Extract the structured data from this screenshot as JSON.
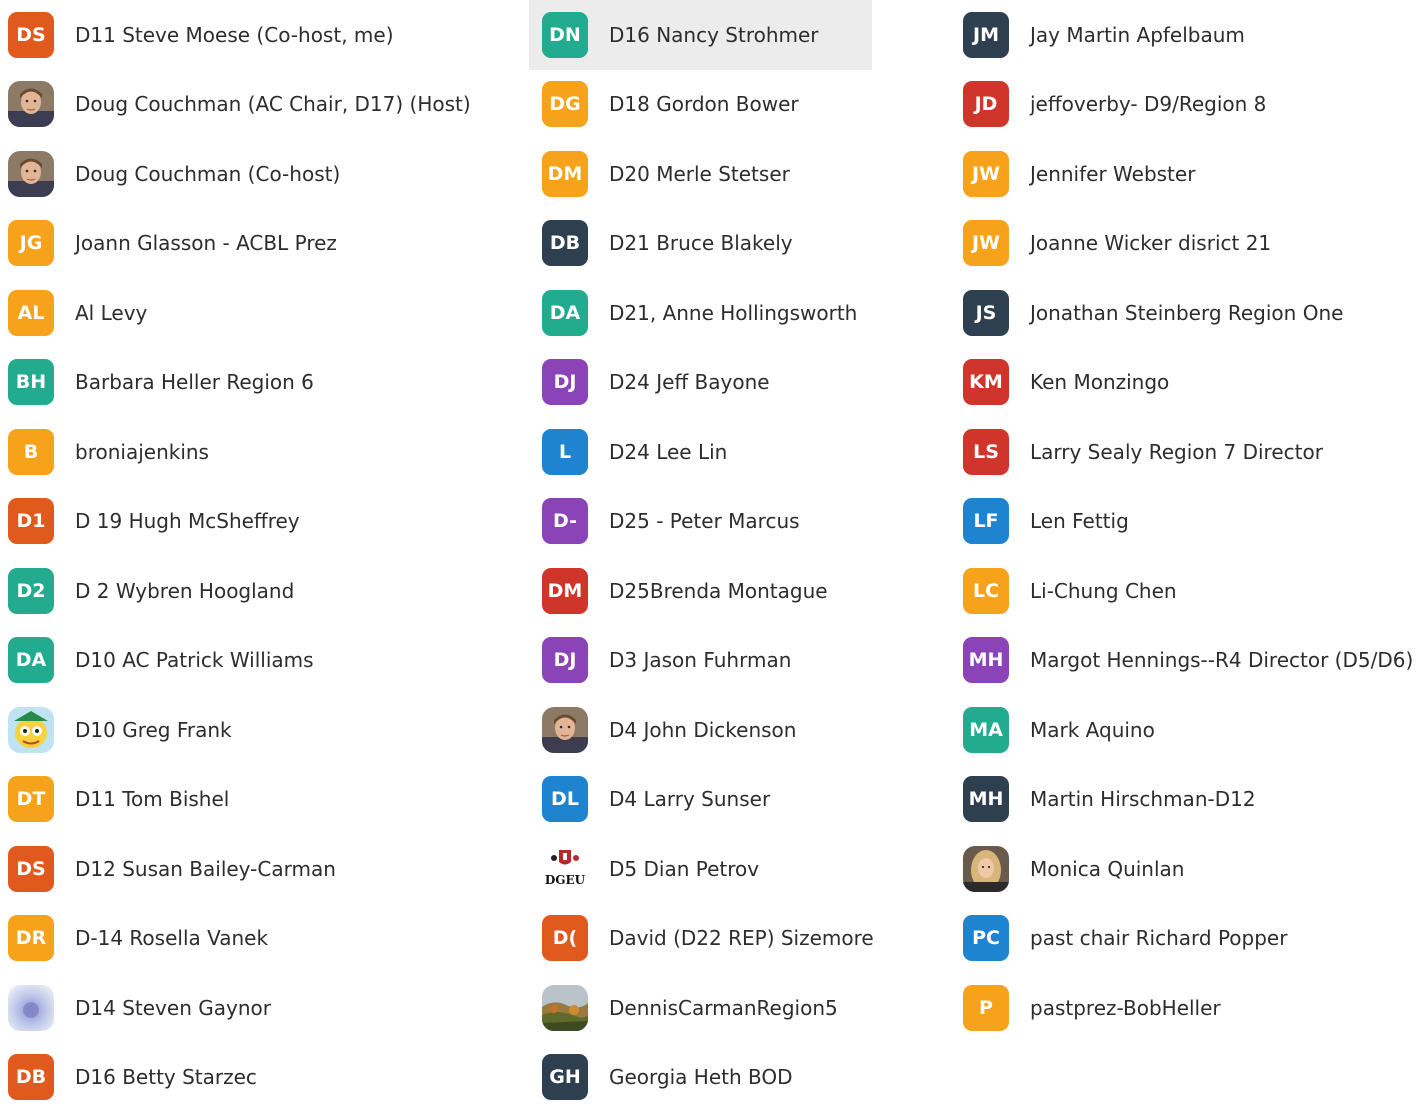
{
  "colors": {
    "orange_red": "#e0591d",
    "orange": "#f6a21a",
    "teal": "#22ab8f",
    "navy": "#2e3f50",
    "purple": "#8b44b8",
    "blue": "#1f84d0",
    "red": "#d0352b",
    "highlight": "#ececec"
  },
  "columns": [
    {
      "participants": [
        {
          "initials": "DS",
          "name": "D11 Steve Moese (Co-host, me)",
          "color": "#e0591d"
        },
        {
          "initials": "",
          "name": "Doug Couchman (AC Chair, D17) (Host)",
          "photo": "man-portrait-photo"
        },
        {
          "initials": "",
          "name": "Doug Couchman (Co-host)",
          "photo": "man-portrait-photo"
        },
        {
          "initials": "JG",
          "name": "Joann Glasson - ACBL Prez",
          "color": "#f6a21a"
        },
        {
          "initials": "AL",
          "name": "Al Levy",
          "color": "#f6a21a"
        },
        {
          "initials": "BH",
          "name": "Barbara Heller Region 6",
          "color": "#22ab8f"
        },
        {
          "initials": "B",
          "name": "broniajenkins",
          "color": "#f6a21a"
        },
        {
          "initials": "D1",
          "name": "D 19   Hugh McSheffrey",
          "color": "#e0591d"
        },
        {
          "initials": "D2",
          "name": "D 2 Wybren Hoogland",
          "color": "#22ab8f"
        },
        {
          "initials": "DA",
          "name": "D10 AC Patrick Williams",
          "color": "#22ab8f"
        },
        {
          "initials": "",
          "name": "D10 Greg Frank",
          "photo": "cartoon-character-photo"
        },
        {
          "initials": "DT",
          "name": "D11 Tom Bishel",
          "color": "#f6a21a"
        },
        {
          "initials": "DS",
          "name": "D12 Susan Bailey-Carman",
          "color": "#e0591d"
        },
        {
          "initials": "DR",
          "name": "D-14 Rosella Vanek",
          "color": "#f6a21a"
        },
        {
          "initials": "",
          "name": "D14 Steven Gaynor",
          "photo": "blurred-abstract-photo"
        },
        {
          "initials": "DB",
          "name": "D16 Betty Starzec",
          "color": "#e0591d"
        }
      ]
    },
    {
      "participants": [
        {
          "initials": "DN",
          "name": "D16 Nancy Strohmer",
          "color": "#22ab8f",
          "highlight": true
        },
        {
          "initials": "DG",
          "name": "D18 Gordon Bower",
          "color": "#f6a21a"
        },
        {
          "initials": "DM",
          "name": "D20 Merle Stetser",
          "color": "#f6a21a"
        },
        {
          "initials": "DB",
          "name": "D21 Bruce Blakely",
          "color": "#2e3f50"
        },
        {
          "initials": "DA",
          "name": "D21, Anne Hollingsworth",
          "color": "#22ab8f"
        },
        {
          "initials": "DJ",
          "name": "D24 Jeff Bayone",
          "color": "#8b44b8"
        },
        {
          "initials": "L",
          "name": "D24 Lee Lin",
          "color": "#1f84d0"
        },
        {
          "initials": "D-",
          "name": "D25 - Peter Marcus",
          "color": "#8b44b8"
        },
        {
          "initials": "DM",
          "name": "D25Brenda Montague",
          "color": "#d0352b"
        },
        {
          "initials": "DJ",
          "name": "D3 Jason Fuhrman",
          "color": "#8b44b8"
        },
        {
          "initials": "",
          "name": "D4 John Dickenson",
          "photo": "man-portrait-photo"
        },
        {
          "initials": "DL",
          "name": "D4 Larry Sunser",
          "color": "#1f84d0"
        },
        {
          "initials": "",
          "name": "D5 Dian Petrov",
          "photo": "logo-image",
          "logo_text": "DGEU"
        },
        {
          "initials": "D(",
          "name": "David (D22 REP) Sizemore",
          "color": "#e0591d"
        },
        {
          "initials": "",
          "name": "DennisCarmanRegion5",
          "photo": "landscape-photo"
        },
        {
          "initials": "GH",
          "name": "Georgia Heth BOD",
          "color": "#2e3f50"
        }
      ]
    },
    {
      "participants": [
        {
          "initials": "JM",
          "name": "Jay Martin Apfelbaum",
          "color": "#2e3f50"
        },
        {
          "initials": "JD",
          "name": "jeffoverby- D9/Region 8",
          "color": "#d0352b"
        },
        {
          "initials": "JW",
          "name": "Jennifer Webster",
          "color": "#f6a21a"
        },
        {
          "initials": "JW",
          "name": "Joanne Wicker disrict 21",
          "color": "#f6a21a"
        },
        {
          "initials": "JS",
          "name": "Jonathan Steinberg Region One",
          "color": "#2e3f50"
        },
        {
          "initials": "KM",
          "name": "Ken Monzingo",
          "color": "#d0352b"
        },
        {
          "initials": "LS",
          "name": "Larry Sealy Region 7 Director",
          "color": "#d0352b"
        },
        {
          "initials": "LF",
          "name": "Len Fettig",
          "color": "#1f84d0"
        },
        {
          "initials": "LC",
          "name": "Li-Chung Chen",
          "color": "#f6a21a"
        },
        {
          "initials": "MH",
          "name": "Margot Hennings--R4 Director (D5/D6)",
          "color": "#8b44b8"
        },
        {
          "initials": "MA",
          "name": "Mark Aquino",
          "color": "#22ab8f"
        },
        {
          "initials": "MH",
          "name": "Martin Hirschman-D12",
          "color": "#2e3f50"
        },
        {
          "initials": "",
          "name": "Monica Quinlan",
          "photo": "woman-portrait-photo"
        },
        {
          "initials": "PC",
          "name": "past chair Richard Popper",
          "color": "#1f84d0"
        },
        {
          "initials": "P",
          "name": "pastprez-BobHeller",
          "color": "#f6a21a"
        }
      ]
    }
  ]
}
